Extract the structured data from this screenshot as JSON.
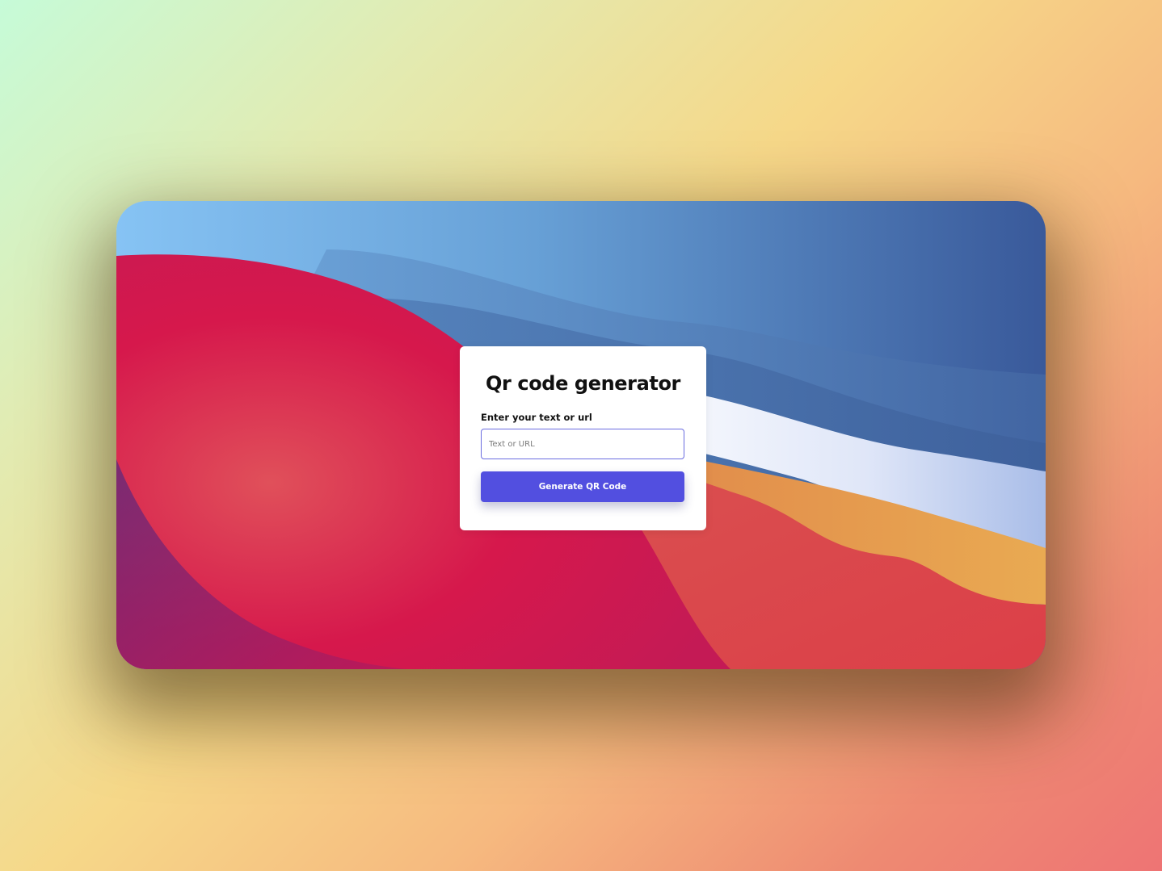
{
  "app": {
    "title": "Qr code generator"
  },
  "form": {
    "label": "Enter your text or url",
    "input_placeholder": "Text or URL",
    "input_value": "",
    "button_label": "Generate QR Code"
  },
  "colors": {
    "accent": "#524fe0",
    "input_border": "#6a6ce0",
    "card_background": "#ffffff"
  }
}
